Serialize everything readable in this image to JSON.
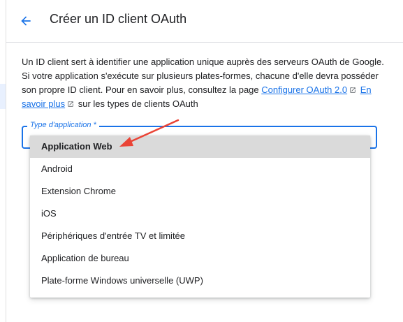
{
  "header": {
    "title": "Créer un ID client OAuth",
    "back_icon": "arrow-back-icon"
  },
  "description": {
    "text_1": "Un ID client sert à identifier une application unique auprès des serveurs OAuth de Google. Si votre application s'exécute sur plusieurs plates-formes, chacune d'elle devra posséder son propre ID client. Pour en savoir plus, consultez la page ",
    "link_1": "Configurer OAuth 2.0",
    "text_2": " ",
    "link_2": "En savoir plus",
    "text_3": " sur les types de clients OAuth",
    "external_icon": "open-in-new-icon"
  },
  "form": {
    "application_type_label": "Type d'application *",
    "selected_value": "Application Web",
    "options": [
      {
        "label": "Application Web",
        "selected": true
      },
      {
        "label": "Android",
        "selected": false
      },
      {
        "label": "Extension Chrome",
        "selected": false
      },
      {
        "label": "iOS",
        "selected": false
      },
      {
        "label": "Périphériques d'entrée TV et limitée",
        "selected": false
      },
      {
        "label": "Application de bureau",
        "selected": false
      },
      {
        "label": "Plate-forme Windows universelle (UWP)",
        "selected": false
      }
    ]
  },
  "colors": {
    "accent": "#1a73e8",
    "annotation_arrow": "#ea4335",
    "selected_option_bg": "#dadada",
    "text": "#202124"
  }
}
